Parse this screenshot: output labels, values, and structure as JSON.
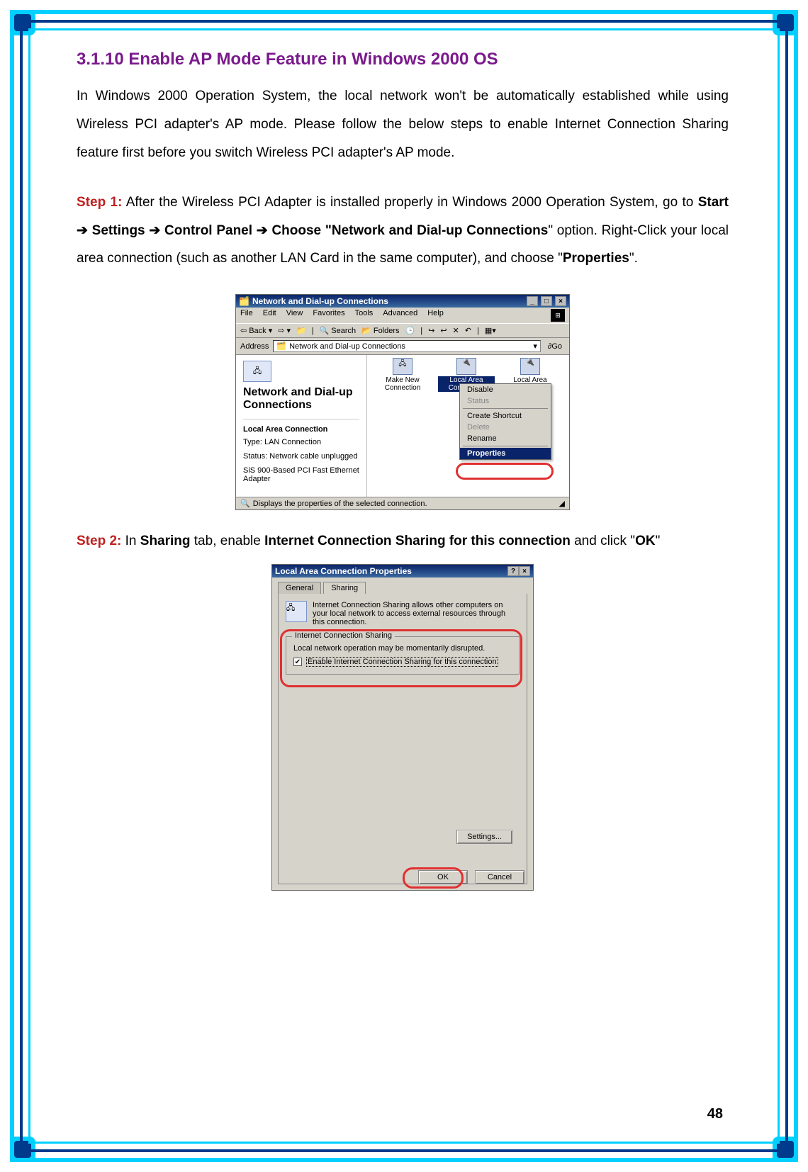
{
  "doc": {
    "section_title": "3.1.10 Enable AP Mode Feature in Windows 2000 OS",
    "intro": "In Windows 2000 Operation System, the local network won't be automatically established while using Wireless PCI adapter's AP mode. Please follow the below steps to enable Internet Connection Sharing feature first before you switch Wireless PCI adapter's AP mode.",
    "step1_label": "Step 1:",
    "step1_a": " After the Wireless PCI Adapter is installed properly in Windows 2000 Operation System, go to ",
    "step1_path1": "Start",
    "step1_path2": "Settings",
    "step1_path3": "Control Panel",
    "step1_path4": "Choose \"Network and Dial-up Connections",
    "step1_b": "\" option. Right-Click your local area connection (such as another LAN Card in the same computer), and choose \"",
    "step1_props": "Properties",
    "step1_c": "\".",
    "step2_label": "Step 2:",
    "step2_a": " In ",
    "step2_b": "Sharing",
    "step2_c": " tab, enable ",
    "step2_d": "Internet Connection Sharing for this connection",
    "step2_e": " and click \"",
    "step2_ok": "OK",
    "step2_f": "\"",
    "page_number": "48"
  },
  "shot1": {
    "title": "Network and Dial-up Connections",
    "menus": [
      "File",
      "Edit",
      "View",
      "Favorites",
      "Tools",
      "Advanced",
      "Help"
    ],
    "toolbar": {
      "back": "Back",
      "search": "Search",
      "folders": "Folders"
    },
    "address_label": "Address",
    "address_value": "Network and Dial-up Connections",
    "go": "Go",
    "left": {
      "heading": "Network and Dial-up Connections",
      "sub": "Local Area Connection",
      "type": "Type: LAN Connection",
      "status": "Status: Network cable unplugged",
      "adapter": "SiS 900-Based PCI Fast Ethernet Adapter"
    },
    "icons": {
      "make_new": "Make New Connection",
      "lac": "Local Area Connection",
      "lac2": "Local Area Connection 2"
    },
    "context": [
      "Disable",
      "Status",
      "Create Shortcut",
      "Delete",
      "Rename",
      "Properties"
    ],
    "statusbar": "Displays the properties of the selected connection."
  },
  "shot2": {
    "title": "Local Area Connection Properties",
    "tabs": {
      "general": "General",
      "sharing": "Sharing"
    },
    "desc": "Internet Connection Sharing allows other computers on your local network to access external resources through this connection.",
    "group_legend": "Internet Connection Sharing",
    "warn": "Local network operation may be momentarily disrupted.",
    "checkbox_label": "Enable Internet Connection Sharing for this connection",
    "settings_btn": "Settings...",
    "ok_btn": "OK",
    "cancel_btn": "Cancel"
  }
}
